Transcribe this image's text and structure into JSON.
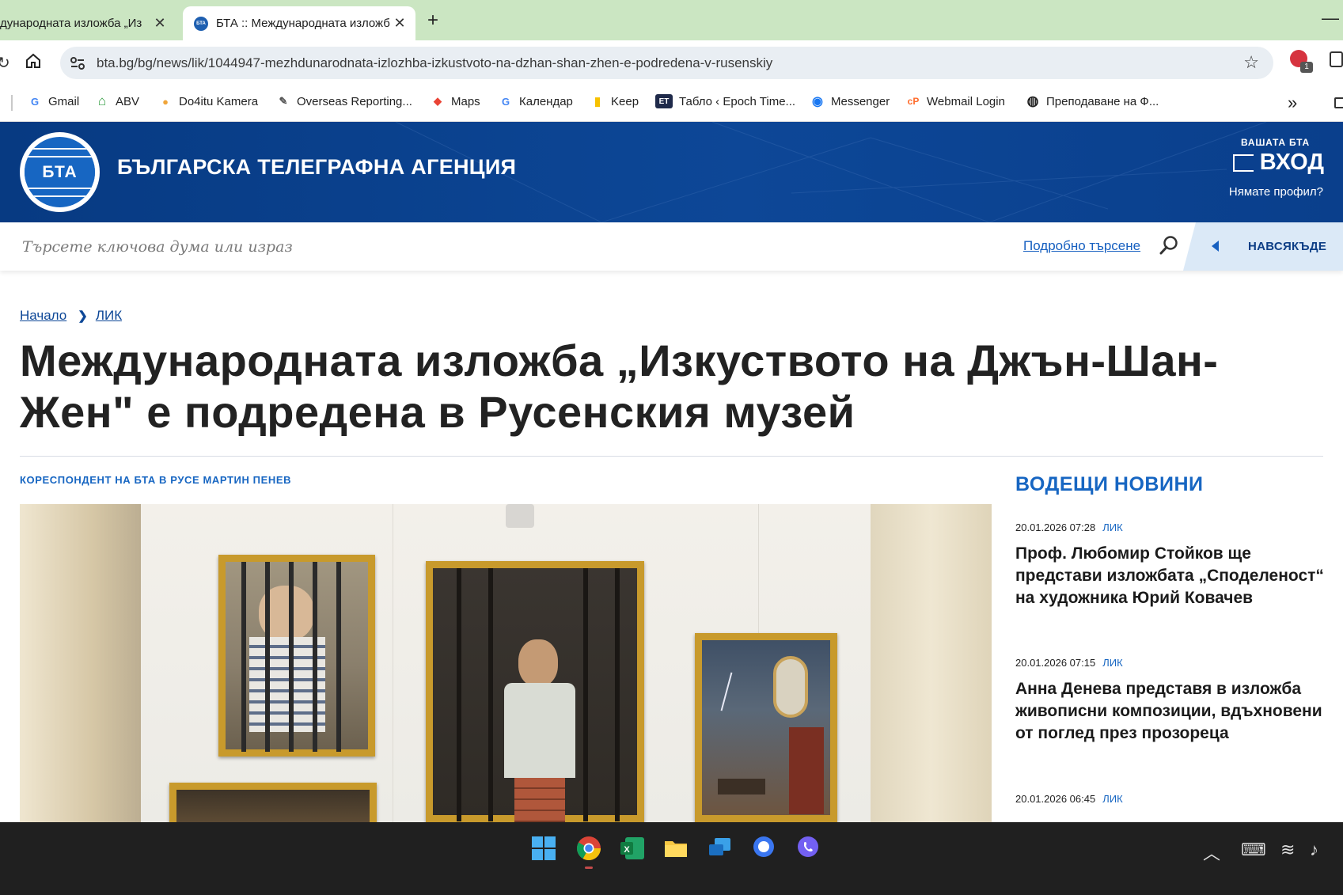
{
  "browser": {
    "tabs": [
      {
        "title": "дународната изложба „Из",
        "active": false
      },
      {
        "title": "БТА :: Международната изложб",
        "active": true
      }
    ],
    "new_tab": "+",
    "url": "bta.bg/bg/news/lik/1044947-mezhdunarodnata-izlozhba-izkustvoto-na-dzhan-shan-zhen-e-podredena-v-rusenskiy",
    "extension_badge": "1",
    "bookmarks": [
      {
        "label": "Gmail",
        "icon": "G"
      },
      {
        "label": "ABV",
        "icon": "⌂"
      },
      {
        "label": "Do4itu Kamera",
        "icon": "●"
      },
      {
        "label": "Overseas Reporting...",
        "icon": "✎"
      },
      {
        "label": "Maps",
        "icon": "◆"
      },
      {
        "label": "Календар",
        "icon": "G"
      },
      {
        "label": "Keep",
        "icon": "▮"
      },
      {
        "label": "Табло ‹ Epoch Time...",
        "icon": "ET"
      },
      {
        "label": "Messenger",
        "icon": "◉"
      },
      {
        "label": "Webmail Login",
        "icon": "cP"
      },
      {
        "label": "Преподаване на Ф...",
        "icon": "◍"
      }
    ],
    "more": "»"
  },
  "site": {
    "logo_text": "БТА",
    "name": "БЪЛГАРСКА ТЕЛЕГРАФНА АГЕНЦИЯ",
    "your_bta": "ВАШАТА БТА",
    "login": "ВХОД",
    "no_profile": "Нямате профил?",
    "search_placeholder": "Търсете ключова дума или израз",
    "advanced_search": "Подробно търсене",
    "scope": "НАВСЯКЪДЕ"
  },
  "article": {
    "breadcrumb": [
      "Начало",
      "ЛИК"
    ],
    "title": "Международната изложба „Изкуството на Джън-Шан-Жен\" е подредена в Русенския музей",
    "correspondent": "КОРЕСПОНДЕНТ НА БТА В РУСЕ МАРТИН ПЕНЕВ"
  },
  "sidebar": {
    "title": "ВОДЕЩИ НОВИНИ",
    "news": [
      {
        "date": "20.01.2026 07:28",
        "category": "ЛИК",
        "title": "Проф. Любомир Стойков ще представи изложбата „Споделеност“ на художника Юрий Ковачев"
      },
      {
        "date": "20.01.2026 07:15",
        "category": "ЛИК",
        "title": "Анна Денева представя в изложба живописни композиции, вдъхновени от поглед през прозореца"
      },
      {
        "date": "20.01.2026 06:45",
        "category": "ЛИК",
        "title": ""
      }
    ]
  },
  "colors": {
    "brand_blue": "#0d4797",
    "link_blue": "#1766c2",
    "tab_strip": "#cbe6c2"
  }
}
